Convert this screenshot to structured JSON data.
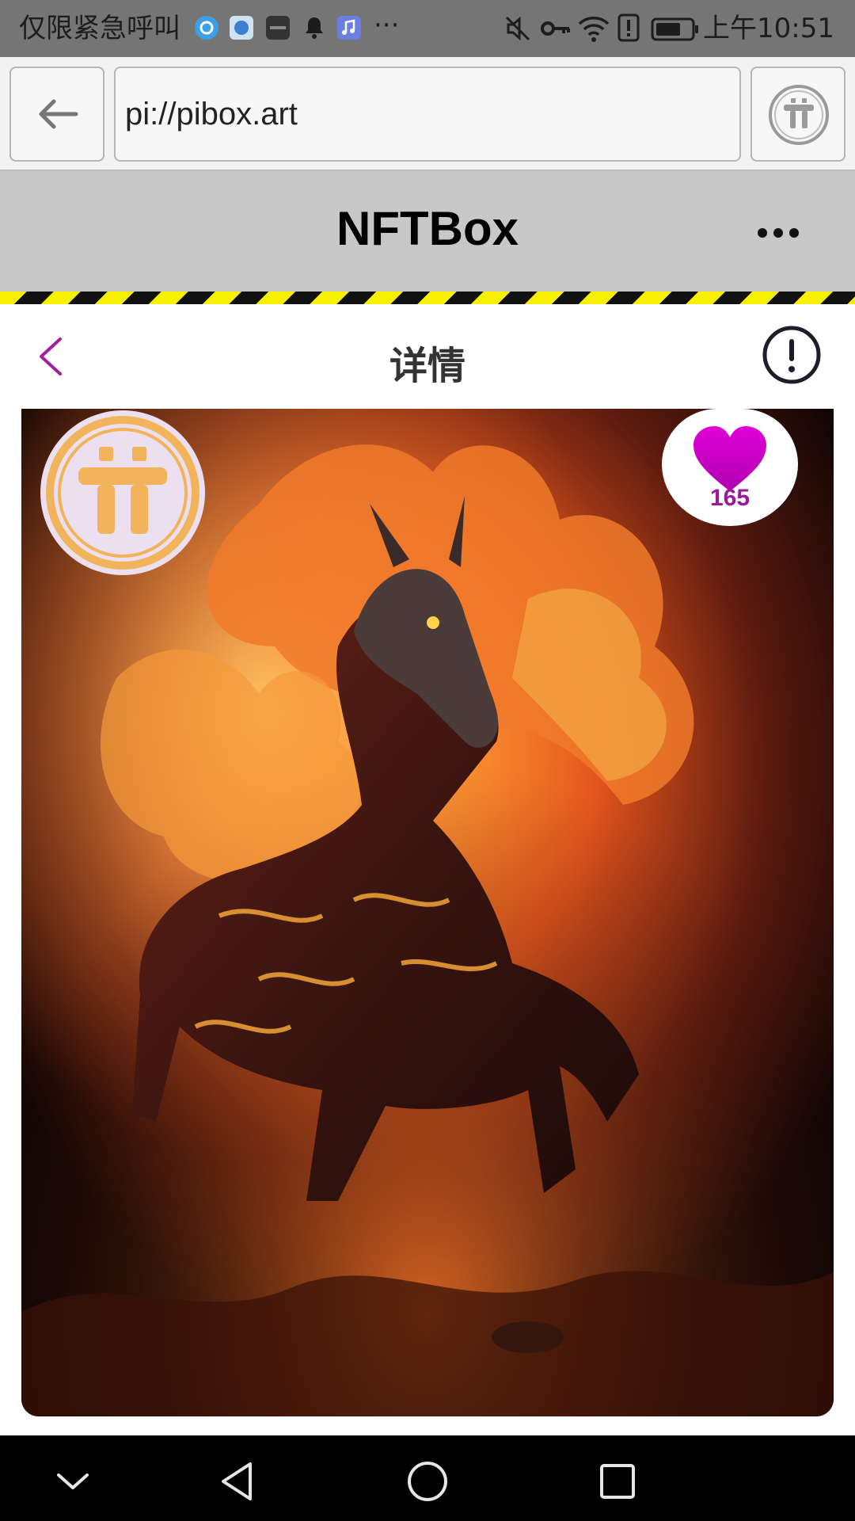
{
  "status_bar": {
    "carrier_text": "仅限紧急呼叫",
    "more_glyph": "···",
    "time": "上午10:51"
  },
  "browser": {
    "url": "pi://pibox.art"
  },
  "app": {
    "title": "NFTBox"
  },
  "detail": {
    "title": "详情"
  },
  "nft": {
    "likes": "165"
  },
  "colors": {
    "status_bar_bg": "#757575",
    "header_bg": "#c8c8c8",
    "accent_purple": "#9b1a9b",
    "heart_magenta": "#e000d8",
    "pi_gold": "#f2b45a",
    "hazard_yellow": "#f7f000"
  },
  "icons": {
    "status": [
      "weibo-icon",
      "browser-icon",
      "huawei-icon",
      "bell-icon",
      "music-icon",
      "mute-icon",
      "key-icon",
      "wifi-icon",
      "alert-icon",
      "battery-icon"
    ],
    "nav": [
      "collapse-chevron-icon",
      "back-triangle-icon",
      "home-circle-icon",
      "recents-square-icon"
    ]
  }
}
